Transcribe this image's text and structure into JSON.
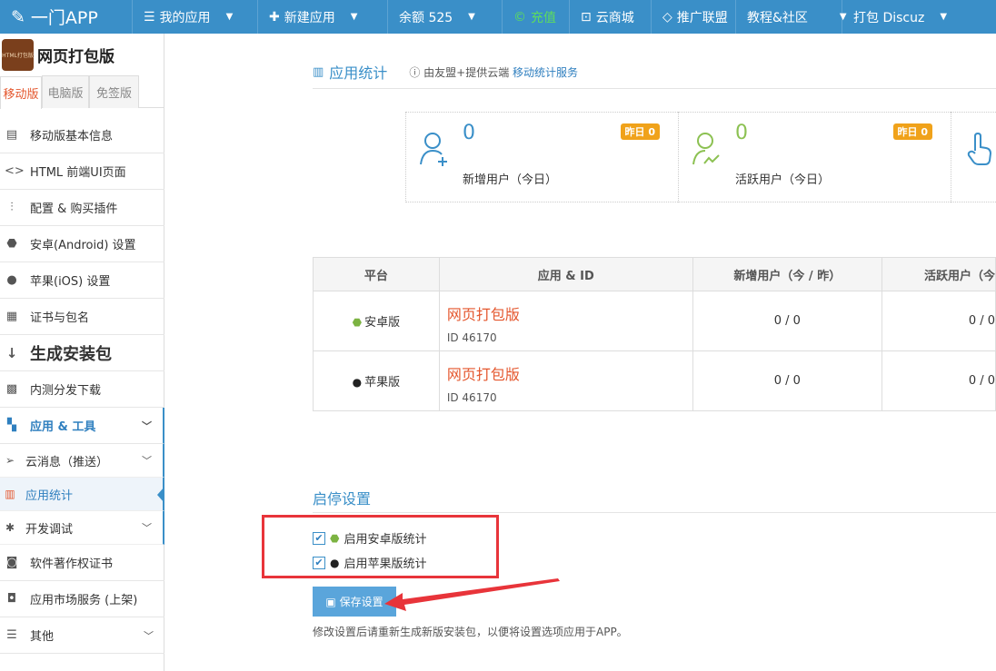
{
  "topnav": {
    "logo": "一门APP",
    "items": [
      {
        "label": "我的应用",
        "icon": "list-icon",
        "caret": true
      },
      {
        "label": "新建应用",
        "icon": "plus-icon",
        "caret": true
      },
      {
        "label": "余额 525",
        "icon": "",
        "caret": true
      },
      {
        "label": "充值",
        "icon": "coin-icon",
        "caret": false
      },
      {
        "label": "云商城",
        "icon": "store-icon",
        "caret": false
      },
      {
        "label": "推广联盟",
        "icon": "diamond-icon",
        "caret": false
      },
      {
        "label": "教程&社区",
        "icon": "",
        "caret": true
      },
      {
        "label": "打包 Discuz",
        "icon": "",
        "caret": true
      }
    ]
  },
  "sidebar": {
    "app_name": "网页打包版",
    "app_thumb_text": "HTML打包版",
    "version_tabs": [
      "移动版",
      "电脑版",
      "免签版"
    ],
    "items": [
      {
        "label": "移动版基本信息"
      },
      {
        "label": "HTML 前端UI页面"
      },
      {
        "label": "配置 & 购买插件"
      },
      {
        "label": "安卓(Android) 设置"
      },
      {
        "label": "苹果(iOS) 设置"
      },
      {
        "label": "证书与包名"
      },
      {
        "label": "生成安装包"
      },
      {
        "label": "内测分发下载"
      },
      {
        "label": "应用 & 工具"
      }
    ],
    "sub_items": [
      {
        "label": "云消息（推送）"
      },
      {
        "label": "应用统计"
      },
      {
        "label": "开发调试"
      }
    ],
    "bottom_items": [
      {
        "label": "软件著作权证书"
      },
      {
        "label": "应用市场服务 (上架)"
      },
      {
        "label": "其他"
      }
    ]
  },
  "main": {
    "stats_title": "应用统计",
    "stats_note": "由友盟+提供云端",
    "stats_note_link": "移动统计服务",
    "cards": [
      {
        "value": "0",
        "label": "新增用户（今日）",
        "badge": "昨日 0"
      },
      {
        "value": "0",
        "label": "活跃用户（今日）",
        "badge": "昨日 0"
      }
    ],
    "table": {
      "headers": [
        "平台",
        "应用 & ID",
        "新增用户（今 / 昨）",
        "活跃用户（今"
      ],
      "rows": [
        {
          "platform": "安卓版",
          "app_name": "网页打包版",
          "app_id": "ID 46170",
          "new_users": "0 / 0",
          "active_users": "0 / 0"
        },
        {
          "platform": "苹果版",
          "app_name": "网页打包版",
          "app_id": "ID 46170",
          "new_users": "0 / 0",
          "active_users": "0 / 0"
        }
      ]
    },
    "toggle_title": "启停设置",
    "options": [
      {
        "label": "启用安卓版统计",
        "checked": true
      },
      {
        "label": "启用苹果版统计",
        "checked": true
      }
    ],
    "save_label": "保存设置",
    "hint": "修改设置后请重新生成新版安装包，以便将设置选项应用于APP。"
  },
  "colors": {
    "primary": "#3a8fc8",
    "accent": "#e4572e",
    "badge": "#f0a21a",
    "annotation": "#e8343a"
  }
}
